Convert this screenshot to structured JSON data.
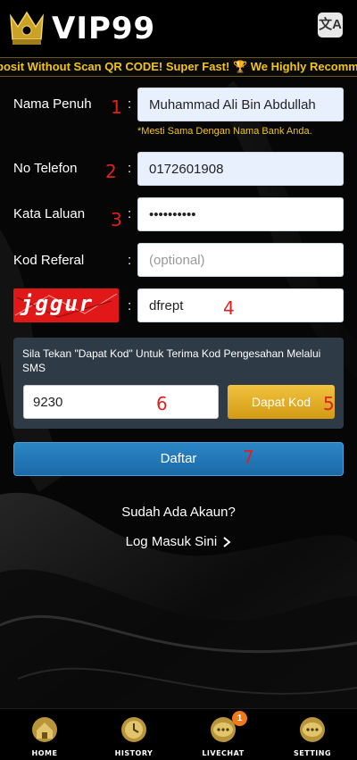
{
  "header": {
    "brand": "VIP99",
    "translate_icon": "translate-icon",
    "marquee": "posit Without Scan QR CODE! Super Fast! 🏆 We Highly Recommend Depo"
  },
  "form": {
    "full_name": {
      "label": "Nama Penuh",
      "value": "Muhammad Ali Bin Abdullah",
      "number": "1",
      "hint": "*Mesti Sama Dengan Nama Bank Anda."
    },
    "phone": {
      "label": "No Telefon",
      "value": "0172601908",
      "number": "2"
    },
    "password": {
      "label": "Kata Laluan",
      "value": "••••••••••",
      "number": "3"
    },
    "referral": {
      "label": "Kod Referal",
      "placeholder": "(optional)"
    },
    "captcha": {
      "image_text": "jggur x",
      "value": "dfrept",
      "number": "4"
    },
    "colon": ":"
  },
  "sms": {
    "instruction": "Sila Tekan \"Dapat Kod\" Untuk Terima Kod Pengesahan Melalui SMS",
    "code_value": "9230",
    "code_number": "6",
    "button_label": "Dapat Kod",
    "button_number": "5"
  },
  "submit": {
    "label": "Daftar",
    "number": "7"
  },
  "login": {
    "question": "Sudah Ada Akaun?",
    "link": "Log Masuk Sini",
    "link_icon": "chevron-right-icon"
  },
  "bottom_nav": [
    {
      "label": "HOME",
      "icon": "home-icon"
    },
    {
      "label": "HISTORY",
      "icon": "clock-icon"
    },
    {
      "label": "LIVECHAT",
      "icon": "chat-icon",
      "badge": "1"
    },
    {
      "label": "SETTING",
      "icon": "settings-icon"
    }
  ],
  "colors": {
    "accent_gold": "#f0c419",
    "primary_blue": "#1a6aa7",
    "error_red": "#e02020"
  }
}
